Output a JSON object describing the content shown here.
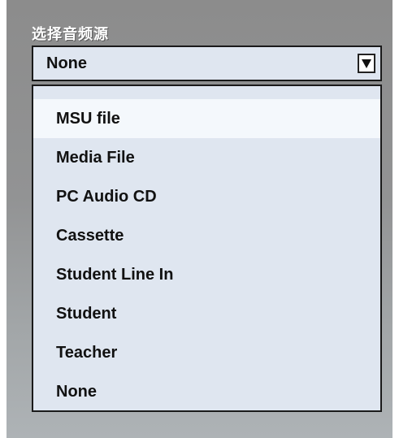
{
  "title": "选择音频源",
  "select": {
    "value": "None",
    "arrow_icon": "triangle-down-icon"
  },
  "options": [
    {
      "label": "MSU file",
      "highlighted": true
    },
    {
      "label": "Media File",
      "highlighted": false
    },
    {
      "label": "PC Audio CD",
      "highlighted": false
    },
    {
      "label": "Cassette",
      "highlighted": false
    },
    {
      "label": "Student Line In",
      "highlighted": false
    },
    {
      "label": "Student",
      "highlighted": false
    },
    {
      "label": "Teacher",
      "highlighted": false
    },
    {
      "label": "None",
      "highlighted": false
    }
  ],
  "colors": {
    "panel_bg": "#929394",
    "dropdown_bg": "#dfe6f0",
    "highlight_bg": "#f4f8fc",
    "border": "#1a1a1a"
  }
}
